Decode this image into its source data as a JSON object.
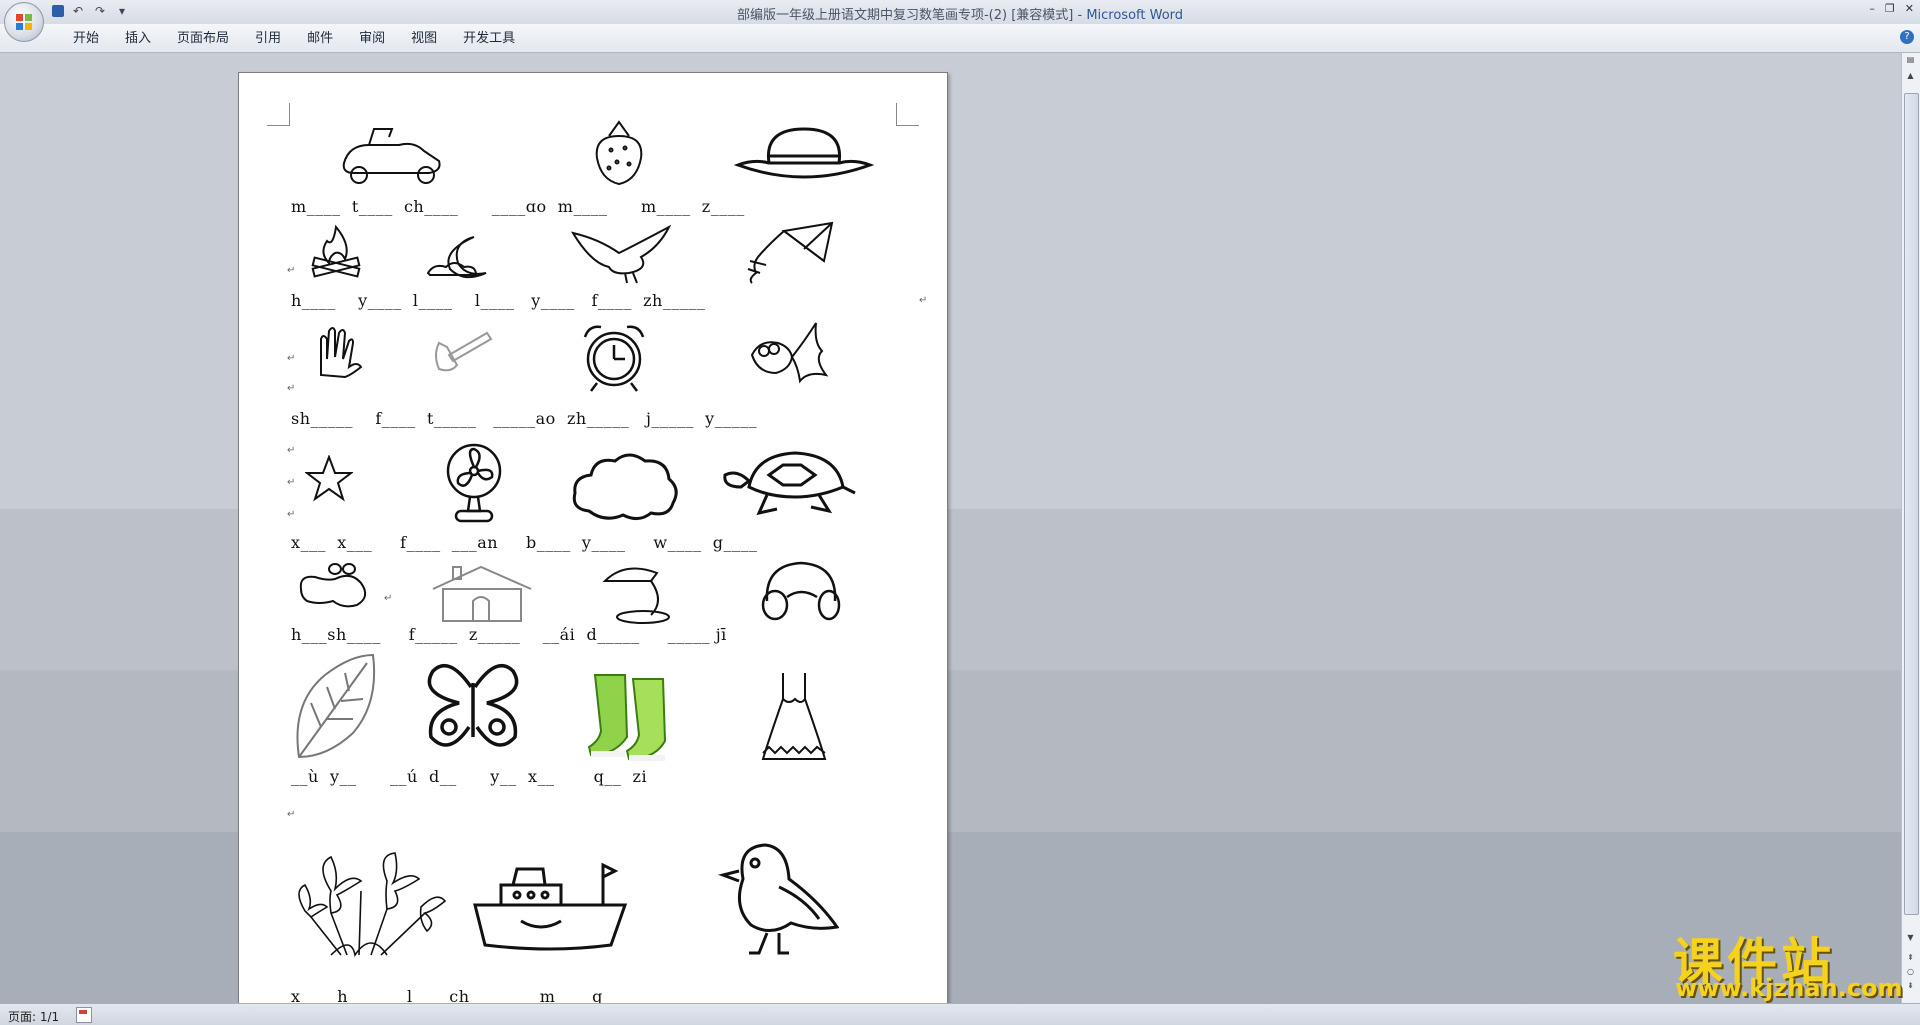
{
  "window": {
    "title": "部编版一年级上册语文期中复习数笔画专项-(2) [兼容模式]",
    "app_name": "Microsoft Word"
  },
  "ribbon": {
    "tabs": [
      "开始",
      "插入",
      "页面布局",
      "引用",
      "邮件",
      "审阅",
      "视图",
      "开发工具"
    ]
  },
  "document": {
    "rows": [
      "m____  t____  ch____      ____ɑo  m____      m____  z____",
      "h____    y____  l____    l____   y____   f____  zh_____",
      "sh_____    f____  t_____   _____ao  zh_____   j_____  y_____",
      "x___  x___     f____  ___an     b____  y____     w____  g____",
      "h___sh____     f_____  z_____    __ái  d_____     _____ jī",
      "__ù  y__      __ú  d__      y__  x__       q__  zi",
      "x___  h___      l___  ch___        m___  q___"
    ],
    "pictures": [
      "scooter",
      "strawberry",
      "hat",
      "campfire",
      "moon",
      "eagle",
      "kite",
      "hand",
      "axe",
      "alarm-clock",
      "goldfish",
      "star",
      "fan",
      "cloud",
      "turtle",
      "peanut",
      "house",
      "desk-lamp",
      "headphones",
      "leaf",
      "butterfly",
      "boots",
      "dress",
      "lily-flowers",
      "ship",
      "bird"
    ]
  },
  "status": {
    "page_label": "页面: 1/1"
  },
  "watermark": {
    "line1": "课件站",
    "line2": "www.kjzhan.com"
  }
}
